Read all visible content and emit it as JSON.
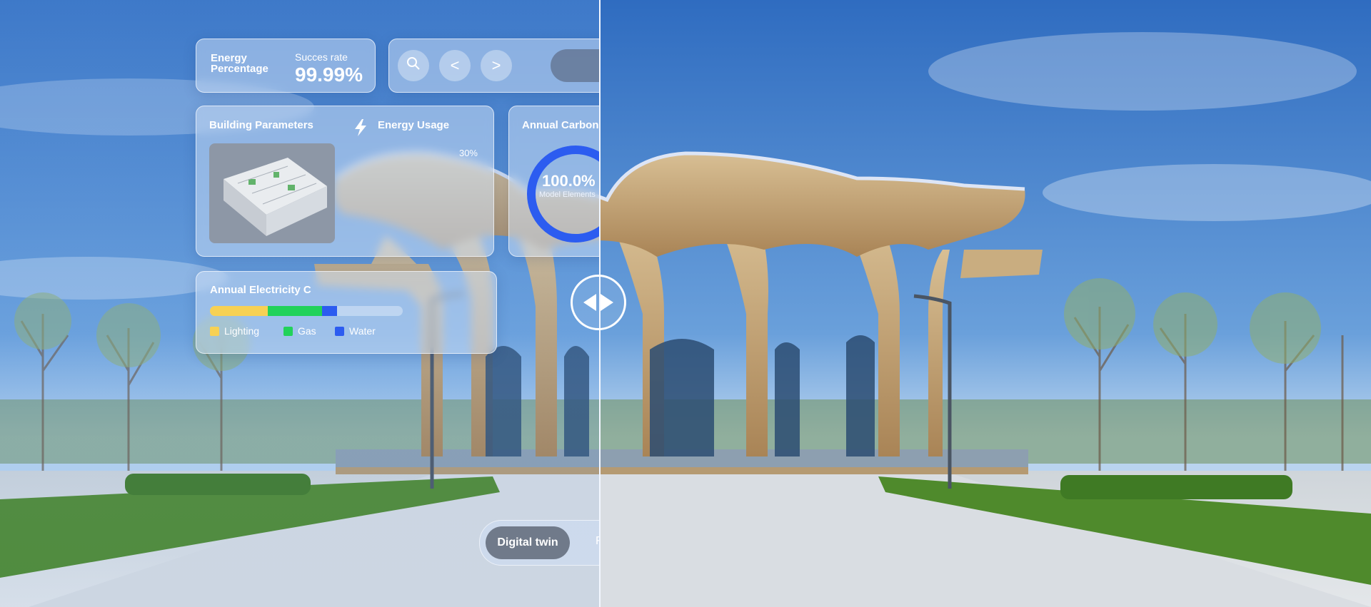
{
  "energy": {
    "label": "Energy Percentage",
    "succes_label": "Succes rate",
    "succes_value": "99.99%"
  },
  "toolbar": {
    "search_icon": "search-icon",
    "prev_label": "<",
    "next_label": ">"
  },
  "params": {
    "title": "Building Parameters",
    "energy_title": "Energy Usage",
    "usage_value": "30%"
  },
  "carbon": {
    "title": "Annual Carbon",
    "value": "100.0%",
    "subtitle": "Model Elements",
    "progress": 1.0
  },
  "electricity": {
    "title": "Annual Electricity C",
    "segments": [
      {
        "name": "Lighting",
        "fraction": 0.3,
        "color": "#f7d154"
      },
      {
        "name": "Gas",
        "fraction": 0.28,
        "color": "#22d25a"
      },
      {
        "name": "Water",
        "fraction": 0.08,
        "color": "#2c5cf0"
      }
    ]
  },
  "mode": {
    "active": "Digital twin",
    "other": "F"
  },
  "colors": {
    "sky": "#3f79c2",
    "accent_blue": "#2c5cf0",
    "glass": "#cddef5"
  }
}
